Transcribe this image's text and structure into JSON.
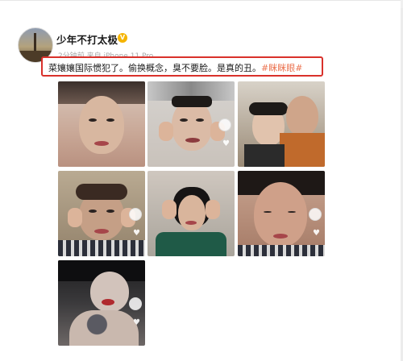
{
  "post": {
    "username": "少年不打太极",
    "vip_badge": "V",
    "meta": "2分钟前  来自 iPhone 11 Pro",
    "text": "菜孃孃国际惯犯了。偷换概念，臭不要脸。是真的丑。",
    "hashtag": "#眯眯眼#"
  },
  "colors": {
    "highlight_border": "#d9312b",
    "hashtag": "#eb7350",
    "username": "#1a1a1a"
  },
  "photos": [
    {
      "name": "photo-1",
      "theme": "woman-close-face"
    },
    {
      "name": "photo-2",
      "theme": "woman-metal-headpiece"
    },
    {
      "name": "photo-3",
      "theme": "two-people-selfie"
    },
    {
      "name": "photo-4",
      "theme": "woman-bangs-hands"
    },
    {
      "name": "photo-5",
      "theme": "woman-green-top-headpiece"
    },
    {
      "name": "photo-6",
      "theme": "woman-eyes-closed"
    },
    {
      "name": "photo-7",
      "theme": "man-red-lips-tattoo"
    }
  ]
}
